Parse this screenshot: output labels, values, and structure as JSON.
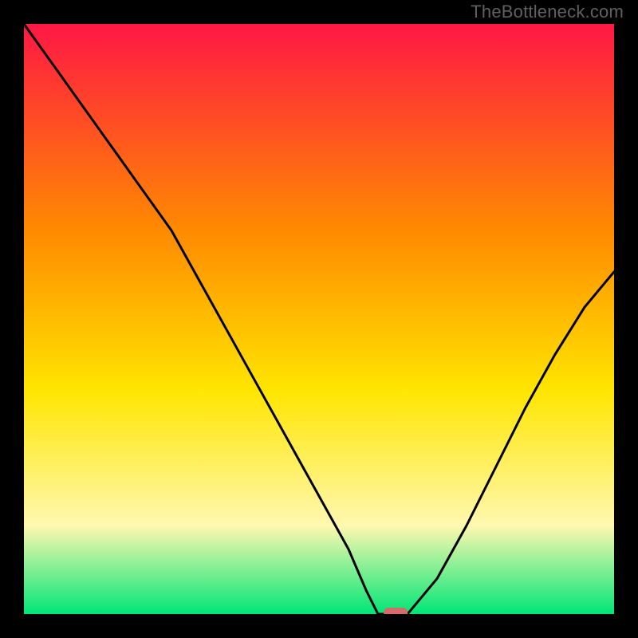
{
  "watermark": "TheBottleneck.com",
  "chart_data": {
    "type": "line",
    "title": "",
    "xlabel": "",
    "ylabel": "",
    "xlim": [
      0,
      100
    ],
    "ylim": [
      0,
      100
    ],
    "x": [
      0,
      5,
      10,
      15,
      20,
      25,
      30,
      35,
      40,
      45,
      50,
      55,
      58,
      60,
      62,
      65,
      70,
      75,
      80,
      85,
      90,
      95,
      100
    ],
    "values": [
      100,
      93,
      86,
      79,
      72,
      65,
      56,
      47,
      38,
      29,
      20,
      11,
      4,
      0,
      0,
      0,
      6,
      15,
      25,
      35,
      44,
      52,
      58
    ],
    "marker": {
      "x": 63,
      "y": 0,
      "color": "#d66a6a"
    },
    "series": [
      {
        "name": "bottleneck-curve",
        "color": "#000000"
      }
    ],
    "background_gradient": {
      "top": "#ff1744",
      "mid1": "#ff8a00",
      "mid2": "#ffe500",
      "low": "#fff8b0",
      "bottom": "#00e676"
    },
    "border_color": "#000000"
  }
}
